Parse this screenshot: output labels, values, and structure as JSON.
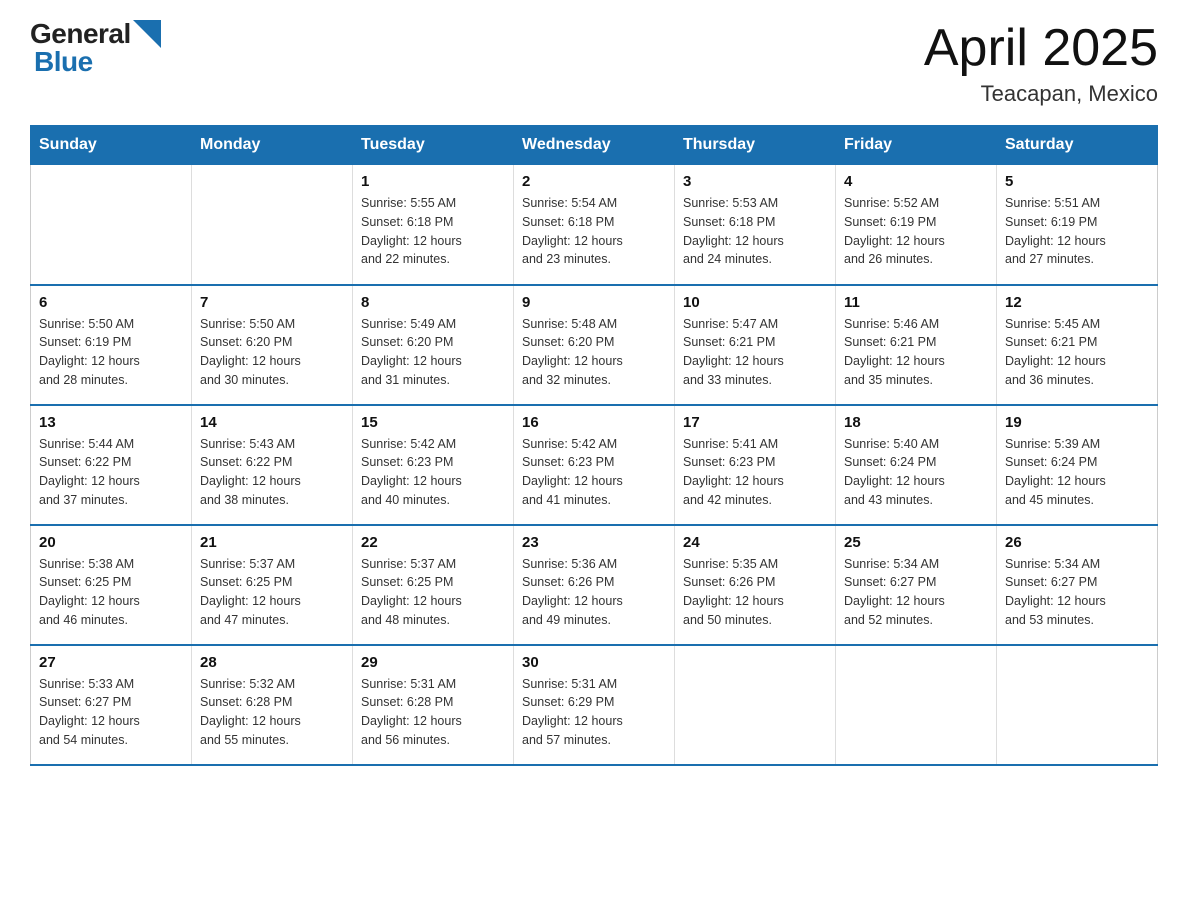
{
  "header": {
    "logo_general": "General",
    "logo_blue": "Blue",
    "title": "April 2025",
    "subtitle": "Teacapan, Mexico"
  },
  "days_of_week": [
    "Sunday",
    "Monday",
    "Tuesday",
    "Wednesday",
    "Thursday",
    "Friday",
    "Saturday"
  ],
  "weeks": [
    [
      {
        "day": "",
        "info": ""
      },
      {
        "day": "",
        "info": ""
      },
      {
        "day": "1",
        "info": "Sunrise: 5:55 AM\nSunset: 6:18 PM\nDaylight: 12 hours\nand 22 minutes."
      },
      {
        "day": "2",
        "info": "Sunrise: 5:54 AM\nSunset: 6:18 PM\nDaylight: 12 hours\nand 23 minutes."
      },
      {
        "day": "3",
        "info": "Sunrise: 5:53 AM\nSunset: 6:18 PM\nDaylight: 12 hours\nand 24 minutes."
      },
      {
        "day": "4",
        "info": "Sunrise: 5:52 AM\nSunset: 6:19 PM\nDaylight: 12 hours\nand 26 minutes."
      },
      {
        "day": "5",
        "info": "Sunrise: 5:51 AM\nSunset: 6:19 PM\nDaylight: 12 hours\nand 27 minutes."
      }
    ],
    [
      {
        "day": "6",
        "info": "Sunrise: 5:50 AM\nSunset: 6:19 PM\nDaylight: 12 hours\nand 28 minutes."
      },
      {
        "day": "7",
        "info": "Sunrise: 5:50 AM\nSunset: 6:20 PM\nDaylight: 12 hours\nand 30 minutes."
      },
      {
        "day": "8",
        "info": "Sunrise: 5:49 AM\nSunset: 6:20 PM\nDaylight: 12 hours\nand 31 minutes."
      },
      {
        "day": "9",
        "info": "Sunrise: 5:48 AM\nSunset: 6:20 PM\nDaylight: 12 hours\nand 32 minutes."
      },
      {
        "day": "10",
        "info": "Sunrise: 5:47 AM\nSunset: 6:21 PM\nDaylight: 12 hours\nand 33 minutes."
      },
      {
        "day": "11",
        "info": "Sunrise: 5:46 AM\nSunset: 6:21 PM\nDaylight: 12 hours\nand 35 minutes."
      },
      {
        "day": "12",
        "info": "Sunrise: 5:45 AM\nSunset: 6:21 PM\nDaylight: 12 hours\nand 36 minutes."
      }
    ],
    [
      {
        "day": "13",
        "info": "Sunrise: 5:44 AM\nSunset: 6:22 PM\nDaylight: 12 hours\nand 37 minutes."
      },
      {
        "day": "14",
        "info": "Sunrise: 5:43 AM\nSunset: 6:22 PM\nDaylight: 12 hours\nand 38 minutes."
      },
      {
        "day": "15",
        "info": "Sunrise: 5:42 AM\nSunset: 6:23 PM\nDaylight: 12 hours\nand 40 minutes."
      },
      {
        "day": "16",
        "info": "Sunrise: 5:42 AM\nSunset: 6:23 PM\nDaylight: 12 hours\nand 41 minutes."
      },
      {
        "day": "17",
        "info": "Sunrise: 5:41 AM\nSunset: 6:23 PM\nDaylight: 12 hours\nand 42 minutes."
      },
      {
        "day": "18",
        "info": "Sunrise: 5:40 AM\nSunset: 6:24 PM\nDaylight: 12 hours\nand 43 minutes."
      },
      {
        "day": "19",
        "info": "Sunrise: 5:39 AM\nSunset: 6:24 PM\nDaylight: 12 hours\nand 45 minutes."
      }
    ],
    [
      {
        "day": "20",
        "info": "Sunrise: 5:38 AM\nSunset: 6:25 PM\nDaylight: 12 hours\nand 46 minutes."
      },
      {
        "day": "21",
        "info": "Sunrise: 5:37 AM\nSunset: 6:25 PM\nDaylight: 12 hours\nand 47 minutes."
      },
      {
        "day": "22",
        "info": "Sunrise: 5:37 AM\nSunset: 6:25 PM\nDaylight: 12 hours\nand 48 minutes."
      },
      {
        "day": "23",
        "info": "Sunrise: 5:36 AM\nSunset: 6:26 PM\nDaylight: 12 hours\nand 49 minutes."
      },
      {
        "day": "24",
        "info": "Sunrise: 5:35 AM\nSunset: 6:26 PM\nDaylight: 12 hours\nand 50 minutes."
      },
      {
        "day": "25",
        "info": "Sunrise: 5:34 AM\nSunset: 6:27 PM\nDaylight: 12 hours\nand 52 minutes."
      },
      {
        "day": "26",
        "info": "Sunrise: 5:34 AM\nSunset: 6:27 PM\nDaylight: 12 hours\nand 53 minutes."
      }
    ],
    [
      {
        "day": "27",
        "info": "Sunrise: 5:33 AM\nSunset: 6:27 PM\nDaylight: 12 hours\nand 54 minutes."
      },
      {
        "day": "28",
        "info": "Sunrise: 5:32 AM\nSunset: 6:28 PM\nDaylight: 12 hours\nand 55 minutes."
      },
      {
        "day": "29",
        "info": "Sunrise: 5:31 AM\nSunset: 6:28 PM\nDaylight: 12 hours\nand 56 minutes."
      },
      {
        "day": "30",
        "info": "Sunrise: 5:31 AM\nSunset: 6:29 PM\nDaylight: 12 hours\nand 57 minutes."
      },
      {
        "day": "",
        "info": ""
      },
      {
        "day": "",
        "info": ""
      },
      {
        "day": "",
        "info": ""
      }
    ]
  ]
}
